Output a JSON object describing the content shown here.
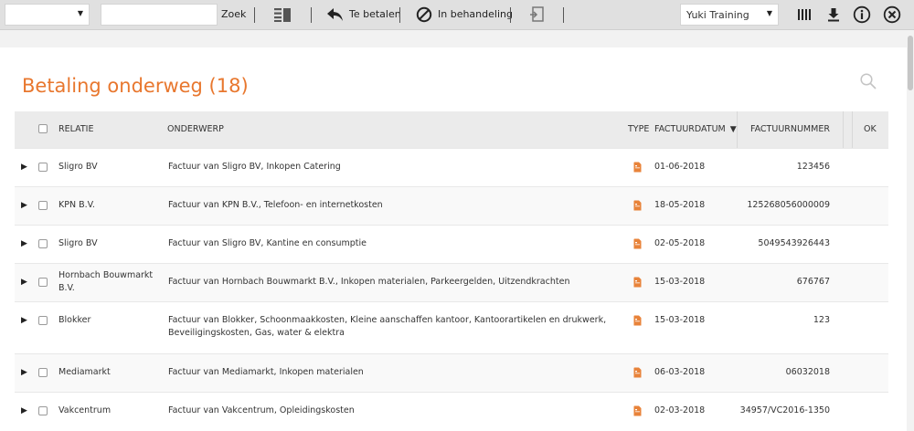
{
  "toolbar": {
    "administration_select": "",
    "search_value": "",
    "search_label": "Zoek",
    "te_betalen_label": "Te betalen",
    "in_behandeling_label": "In behandeling",
    "company_select": "Yuki Training"
  },
  "page": {
    "title": "Betaling onderweg (18)"
  },
  "table": {
    "columns": {
      "relatie": "RELATIE",
      "onderwerp": "ONDERWERP",
      "type": "TYPE",
      "factuurdatum": "FACTUURDATUM",
      "factuurnummer": "FACTUURNUMMER",
      "ok": "OK"
    },
    "rows": [
      {
        "relatie": "Sligro BV",
        "onderwerp": "Factuur van Sligro BV, Inkopen Catering",
        "datum": "01-06-2018",
        "nummer": "123456"
      },
      {
        "relatie": "KPN B.V.",
        "onderwerp": "Factuur van KPN B.V., Telefoon- en internetkosten",
        "datum": "18-05-2018",
        "nummer": "125268056000009"
      },
      {
        "relatie": "Sligro BV",
        "onderwerp": "Factuur van Sligro BV, Kantine en consumptie",
        "datum": "02-05-2018",
        "nummer": "5049543926443"
      },
      {
        "relatie": "Hornbach Bouwmarkt B.V.",
        "onderwerp": "Factuur van Hornbach Bouwmarkt B.V., Inkopen materialen, Parkeergelden, Uitzendkrachten",
        "datum": "15-03-2018",
        "nummer": "676767"
      },
      {
        "relatie": "Blokker",
        "onderwerp": "Factuur van Blokker, Schoonmaakkosten, Kleine aanschaffen kantoor, Kantoorartikelen en drukwerk, Beveiligingskosten, Gas, water & elektra",
        "datum": "15-03-2018",
        "nummer": "123"
      },
      {
        "relatie": "Mediamarkt",
        "onderwerp": "Factuur van Mediamarkt, Inkopen materialen",
        "datum": "06-03-2018",
        "nummer": "06032018"
      },
      {
        "relatie": "Vakcentrum",
        "onderwerp": "Factuur van Vakcentrum, Opleidingskosten",
        "datum": "02-03-2018",
        "nummer": "34957/VC2016-1350"
      }
    ]
  },
  "colors": {
    "accent": "#e8772e",
    "doc_icon": "#e8833a"
  }
}
